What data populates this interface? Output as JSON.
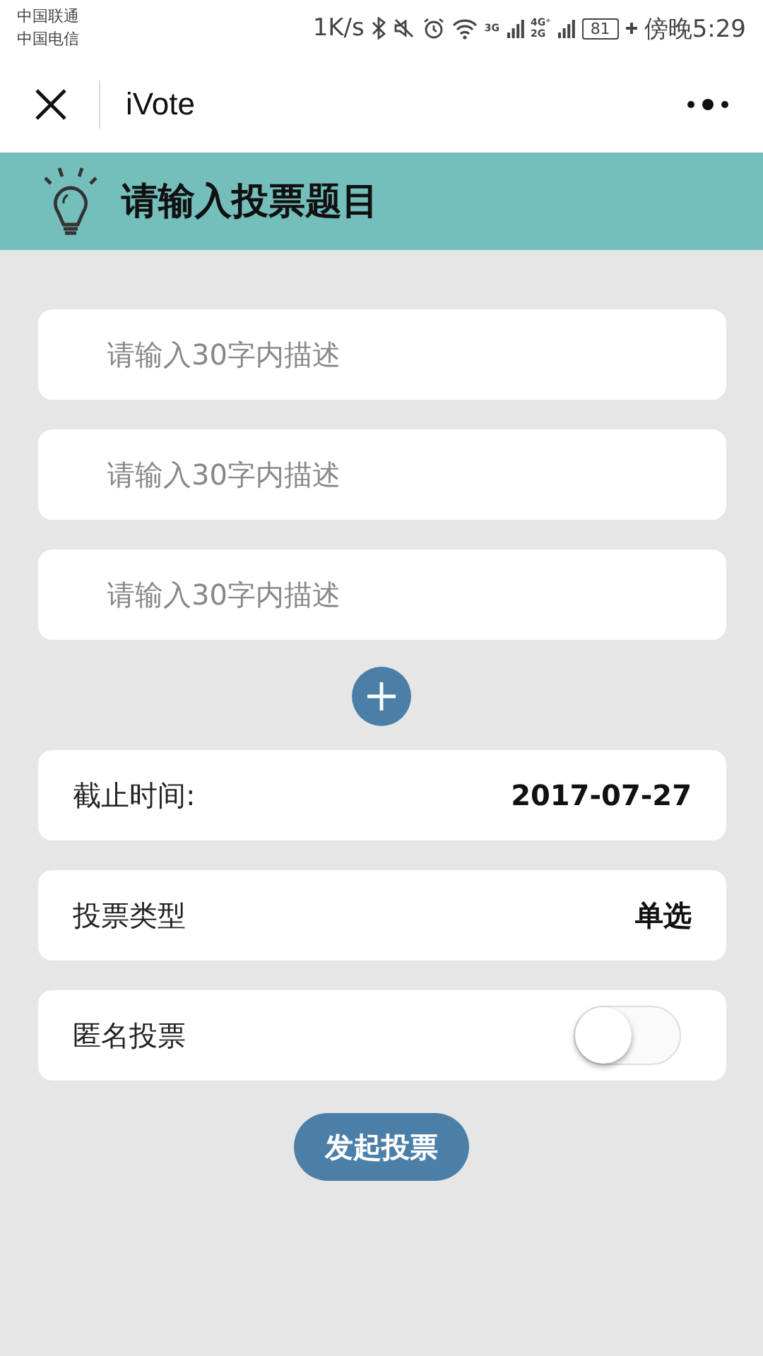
{
  "status_bar": {
    "carriers": [
      "中国联通",
      "中国电信"
    ],
    "speed": "1K/s",
    "network_3g": "3G",
    "network_4g": "4G⁺",
    "network_2g": "2G",
    "battery": "81",
    "time": "傍晚5:29"
  },
  "nav": {
    "title": "iVote"
  },
  "banner": {
    "title": "请输入投票题目"
  },
  "options": [
    {
      "placeholder": "请输入30字内描述"
    },
    {
      "placeholder": "请输入30字内描述"
    },
    {
      "placeholder": "请输入30字内描述"
    }
  ],
  "settings": [
    {
      "kind": "value",
      "label": "截止时间:",
      "value": "2017-07-27"
    },
    {
      "kind": "value",
      "label": "投票类型",
      "value": "单选"
    },
    {
      "kind": "switch",
      "label": "匿名投票",
      "on": false
    }
  ],
  "submit": {
    "label": "发起投票"
  }
}
